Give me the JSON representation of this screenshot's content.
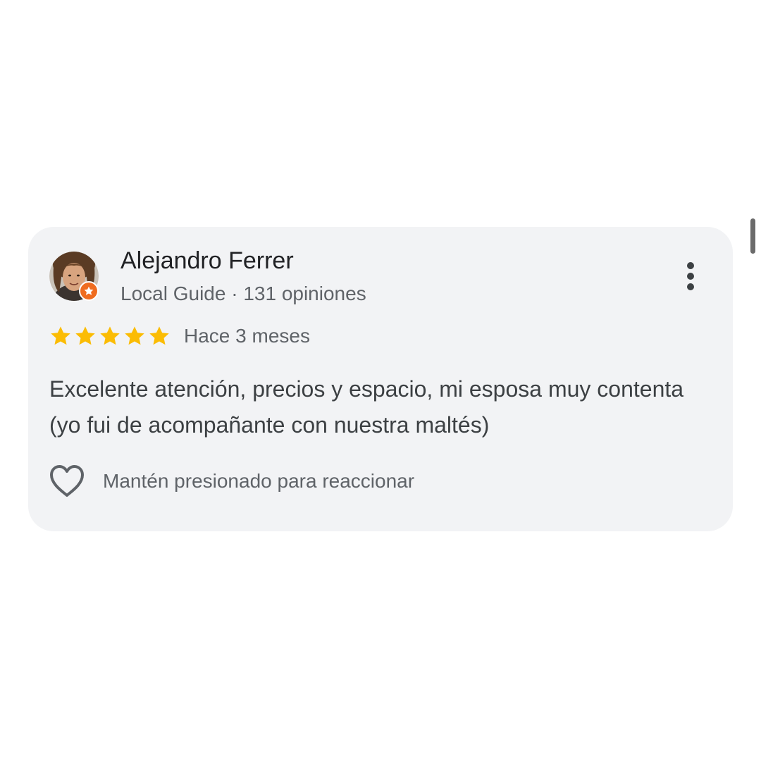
{
  "review": {
    "author": {
      "name": "Alejandro Ferrer",
      "meta": "Local Guide · 131 opiniones",
      "badge_icon": "local-guide-star-icon",
      "badge_color": "#ef6c1f"
    },
    "rating": {
      "stars": 5,
      "max": 5,
      "star_color": "#fbbc04"
    },
    "date": "Hace 3 meses",
    "text": "Excelente atención, precios y espacio, mi esposa muy contenta (yo fui de acompañante con nuestra maltés)",
    "more_options_icon": "more-vert-icon",
    "reaction": {
      "icon": "heart-outline-icon",
      "label": "Mantén presionado para reaccionar"
    }
  },
  "colors": {
    "card_background": "#f2f3f5",
    "text_primary": "#202124",
    "text_secondary": "#5f6368"
  }
}
